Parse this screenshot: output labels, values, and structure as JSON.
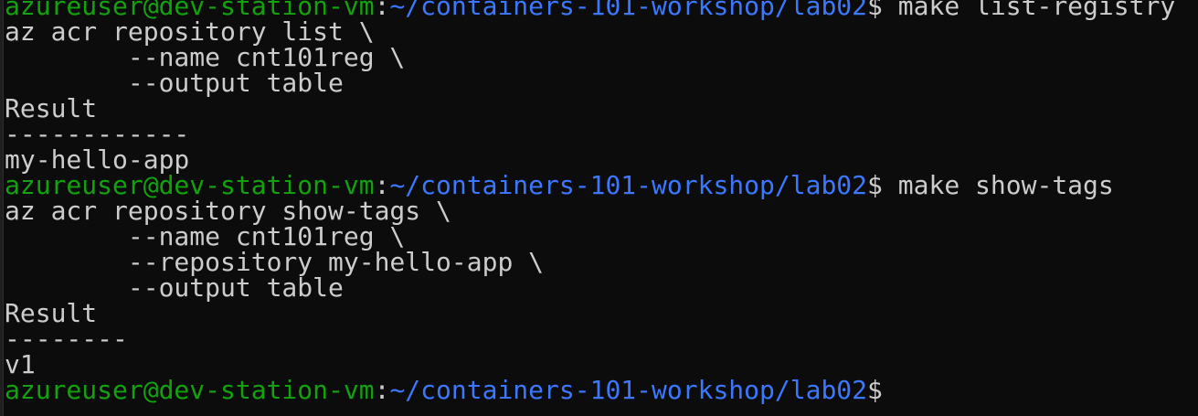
{
  "prompt": {
    "user_host": "azureuser@dev-station-vm",
    "separator": ":",
    "path": "~/containers-101-workshop/lab02",
    "symbol": "$"
  },
  "colors": {
    "background": "#0c0c0c",
    "prompt_user": "#13a10e",
    "prompt_path": "#3b78ff",
    "text": "#cccccc"
  },
  "session": {
    "cmd1": " make list-registry",
    "cmd1_out": [
      "az acr repository list \\",
      "        --name cnt101reg \\",
      "        --output table",
      "Result",
      "------------",
      "my-hello-app"
    ],
    "cmd2": " make show-tags",
    "cmd2_out": [
      "az acr repository show-tags \\",
      "        --name cnt101reg \\",
      "        --repository my-hello-app \\",
      "        --output table",
      "Result",
      "--------",
      "v1"
    ]
  }
}
